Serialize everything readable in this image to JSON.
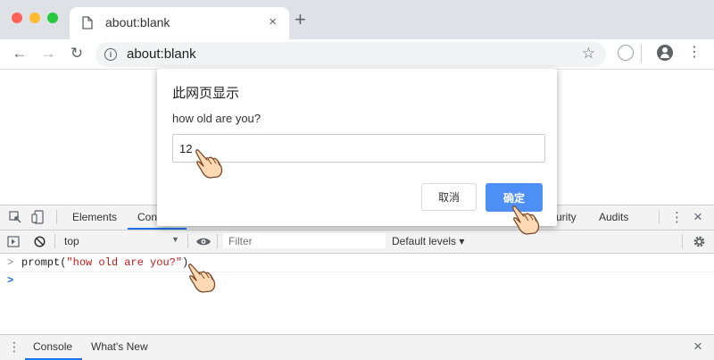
{
  "tab": {
    "title": "about:blank",
    "close_icon": "×",
    "new_tab": "+"
  },
  "toolbar": {
    "back": "←",
    "forward": "→",
    "reload": "↻",
    "url": "about:blank",
    "star": "☆",
    "menu": "⋮"
  },
  "devtools": {
    "tabs": [
      "Elements",
      "Console",
      "urity",
      "Audits"
    ],
    "context": "top",
    "filter_placeholder": "Filter",
    "levels": "Default levels ▾",
    "console_lines": [
      {
        "prefix": ">",
        "code_fn": "prompt(",
        "code_str": "\"how old are you?\"",
        "code_end": ")"
      },
      {
        "prefix": ">",
        "code_fn": "",
        "code_str": "",
        "code_end": ""
      }
    ],
    "drawer_tabs": [
      "Console",
      "What's New"
    ],
    "close": "×",
    "more": "⋮"
  },
  "dialog": {
    "header": "此网页显示",
    "message": "how old are you?",
    "input_value": "12",
    "cancel_label": "取消",
    "ok_label": "确定"
  },
  "colors": {
    "accent": "#4d8ff5",
    "string": "#c41a16",
    "prompt_blue": "#1a73e8"
  }
}
